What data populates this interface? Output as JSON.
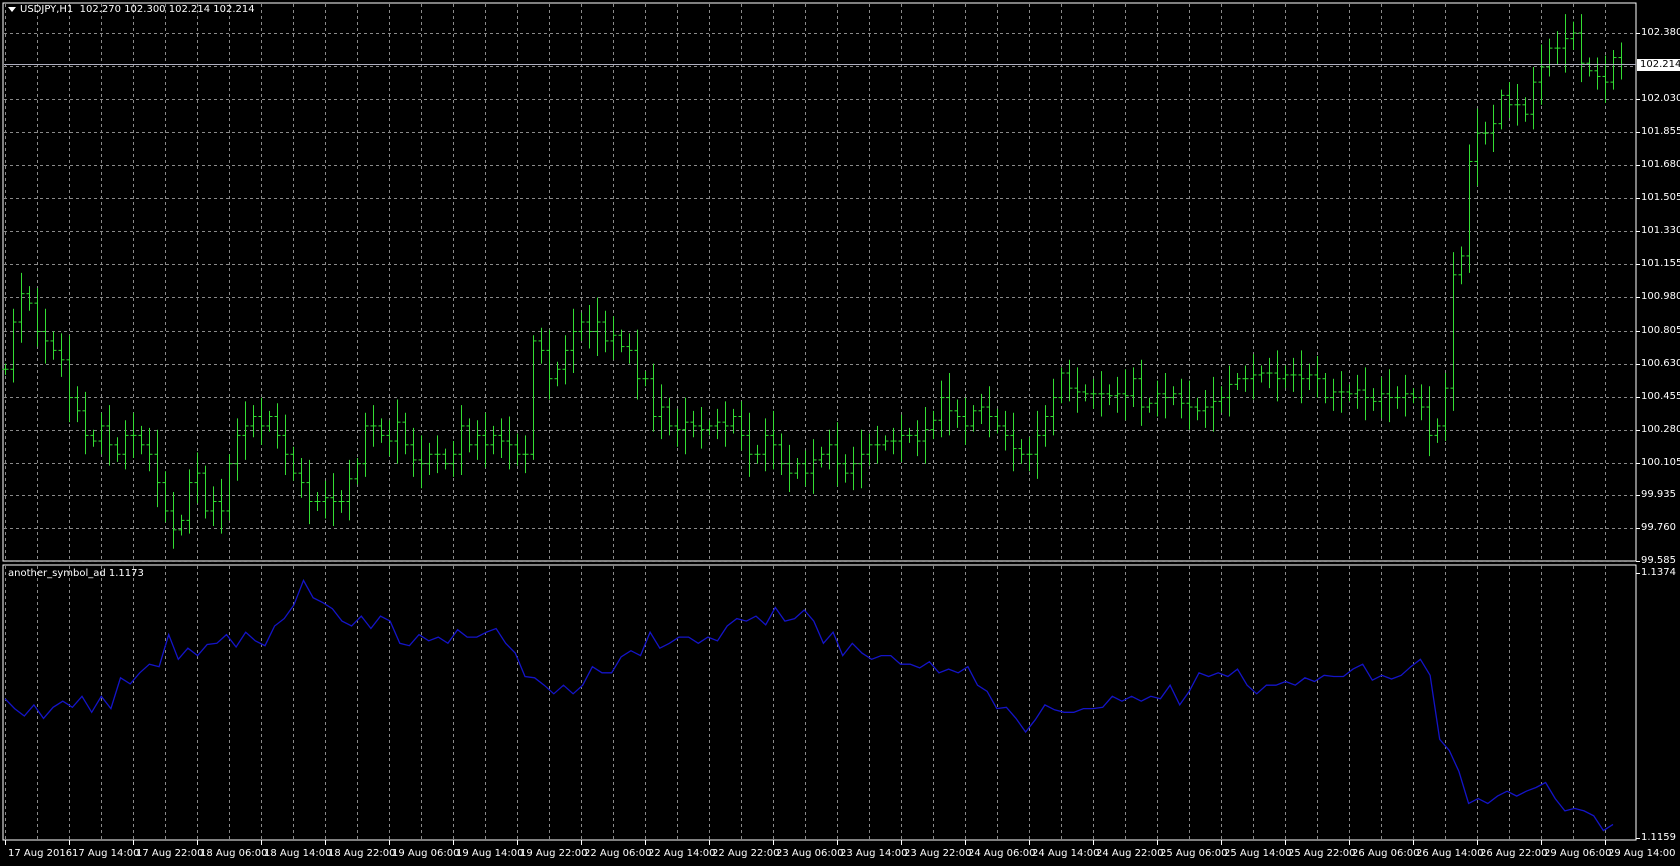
{
  "header": {
    "symbol": "USDJPY,H1",
    "ohlc": "102.270 102.300 102.214 102.214"
  },
  "indicator": {
    "label": "another_symbol_ad 1.1173"
  },
  "bid_label": "102.214",
  "colors": {
    "bars": "#33dd33",
    "indicator": "#1414c8",
    "grid": "#8a8a8a",
    "background": "#000000",
    "frame": "#ffffff"
  },
  "price_axis": [
    "102.380",
    "102.030",
    "101.855",
    "101.680",
    "101.505",
    "101.330",
    "101.155",
    "100.980",
    "100.805",
    "100.630",
    "100.455",
    "100.280",
    "100.105",
    "99.935",
    "99.760",
    "99.585"
  ],
  "indicator_axis": [
    "1.1374",
    "1.1159"
  ],
  "time_axis": [
    "17 Aug 2016",
    "17 Aug 14:00",
    "17 Aug 22:00",
    "18 Aug 06:00",
    "18 Aug 14:00",
    "18 Aug 22:00",
    "19 Aug 06:00",
    "19 Aug 14:00",
    "19 Aug 22:00",
    "22 Aug 06:00",
    "22 Aug 14:00",
    "22 Aug 22:00",
    "23 Aug 06:00",
    "23 Aug 14:00",
    "23 Aug 22:00",
    "24 Aug 06:00",
    "24 Aug 14:00",
    "24 Aug 22:00",
    "25 Aug 06:00",
    "25 Aug 14:00",
    "25 Aug 22:00",
    "26 Aug 06:00",
    "26 Aug 14:00",
    "26 Aug 22:00",
    "29 Aug 06:00",
    "29 Aug 14:00"
  ],
  "chart_data": [
    {
      "type": "ohlc",
      "title": "USDJPY,H1",
      "ylim": [
        99.585,
        102.38
      ],
      "bid": 102.214,
      "closes": [
        100.6,
        100.85,
        101.0,
        100.95,
        100.8,
        100.75,
        100.7,
        100.65,
        100.45,
        100.38,
        100.25,
        100.22,
        100.3,
        100.2,
        100.15,
        100.25,
        100.25,
        100.2,
        100.15,
        100.0,
        99.85,
        99.75,
        99.8,
        100.0,
        100.05,
        99.85,
        99.9,
        99.85,
        100.1,
        100.25,
        100.3,
        100.35,
        100.3,
        100.35,
        100.25,
        100.15,
        100.05,
        100.0,
        99.9,
        99.9,
        99.92,
        99.9,
        99.9,
        100.02,
        100.1,
        100.3,
        100.3,
        100.25,
        100.22,
        100.32,
        100.2,
        100.12,
        100.1,
        100.15,
        100.15,
        100.1,
        100.15,
        100.3,
        100.2,
        100.25,
        100.2,
        100.25,
        100.22,
        100.2,
        100.15,
        100.15,
        100.75,
        100.7,
        100.55,
        100.6,
        100.7,
        100.8,
        100.85,
        100.8,
        100.85,
        100.75,
        100.78,
        100.72,
        100.7,
        100.55,
        100.55,
        100.35,
        100.4,
        100.3,
        100.28,
        100.32,
        100.3,
        100.28,
        100.3,
        100.32,
        100.3,
        100.35,
        100.25,
        100.15,
        100.15,
        100.25,
        100.2,
        100.1,
        100.05,
        100.1,
        100.05,
        100.12,
        100.15,
        100.2,
        100.1,
        100.05,
        100.1,
        100.15,
        100.2,
        100.2,
        100.22,
        100.22,
        100.25,
        100.25,
        100.22,
        100.28,
        100.33,
        100.45,
        100.38,
        100.35,
        100.3,
        100.38,
        100.4,
        100.35,
        100.3,
        100.25,
        100.18,
        100.15,
        100.15,
        100.25,
        100.35,
        100.45,
        100.58,
        100.5,
        100.48,
        100.47,
        100.47,
        100.47,
        100.46,
        100.47,
        100.46,
        100.55,
        100.4,
        100.42,
        100.47,
        100.45,
        100.47,
        100.42,
        100.4,
        100.38,
        100.4,
        100.43,
        100.45,
        100.52,
        100.55,
        100.55,
        100.57,
        100.58,
        100.58,
        100.55,
        100.57,
        100.57,
        100.55,
        100.57,
        100.55,
        100.45,
        100.48,
        100.48,
        100.47,
        100.49,
        100.45,
        100.43,
        100.47,
        100.45,
        100.45,
        100.47,
        100.45,
        100.4,
        100.25,
        100.3,
        100.5,
        101.1,
        101.2,
        101.7,
        101.85,
        101.85,
        101.9,
        102.05,
        102.0,
        102.0,
        101.95,
        102.12,
        102.2,
        102.3,
        102.3,
        102.35,
        102.38,
        102.22,
        102.18,
        102.15,
        102.12,
        102.25,
        102.214
      ]
    },
    {
      "type": "line",
      "title": "another_symbol_ad",
      "ylim": [
        1.1159,
        1.1374
      ],
      "last": 1.1173,
      "values": [
        1.1272,
        1.1264,
        1.1258,
        1.1267,
        1.1256,
        1.1265,
        1.127,
        1.1265,
        1.1274,
        1.1261,
        1.1274,
        1.1264,
        1.1289,
        1.1284,
        1.1293,
        1.13,
        1.1298,
        1.1324,
        1.1304,
        1.1313,
        1.1307,
        1.1316,
        1.1317,
        1.1324,
        1.1314,
        1.1326,
        1.1319,
        1.1315,
        1.1331,
        1.1337,
        1.1348,
        1.1368,
        1.1354,
        1.135,
        1.1345,
        1.1335,
        1.1331,
        1.1339,
        1.1329,
        1.1339,
        1.1335,
        1.1317,
        1.1315,
        1.1324,
        1.1319,
        1.1322,
        1.1317,
        1.1328,
        1.1322,
        1.1322,
        1.1326,
        1.1329,
        1.1317,
        1.1309,
        1.129,
        1.1289,
        1.1283,
        1.1276,
        1.1283,
        1.1276,
        1.1283,
        1.1298,
        1.1293,
        1.1293,
        1.1306,
        1.1311,
        1.1307,
        1.1326,
        1.1313,
        1.1317,
        1.1322,
        1.1322,
        1.1317,
        1.1322,
        1.1319,
        1.1331,
        1.1337,
        1.1335,
        1.1339,
        1.1332,
        1.1346,
        1.1335,
        1.1337,
        1.1344,
        1.1335,
        1.1317,
        1.1326,
        1.1307,
        1.1317,
        1.1309,
        1.1304,
        1.1307,
        1.1307,
        1.13,
        1.13,
        1.1297,
        1.1302,
        1.1293,
        1.1296,
        1.1293,
        1.1298,
        1.1283,
        1.1278,
        1.1264,
        1.1265,
        1.1256,
        1.1245,
        1.1255,
        1.1267,
        1.1263,
        1.1261,
        1.1261,
        1.1264,
        1.1264,
        1.1265,
        1.1274,
        1.127,
        1.1274,
        1.127,
        1.1274,
        1.1272,
        1.1283,
        1.1267,
        1.1278,
        1.1293,
        1.129,
        1.1293,
        1.129,
        1.1296,
        1.1283,
        1.1276,
        1.1283,
        1.1283,
        1.1286,
        1.1283,
        1.1289,
        1.1286,
        1.1291,
        1.129,
        1.129,
        1.1296,
        1.13,
        1.1287,
        1.1291,
        1.1288,
        1.1291,
        1.1298,
        1.1304,
        1.1291,
        1.1239,
        1.123,
        1.1213,
        1.1187,
        1.1191,
        1.1187,
        1.1193,
        1.1197,
        1.1193,
        1.1197,
        1.12,
        1.1204,
        1.1191,
        1.1181,
        1.1183,
        1.1181,
        1.1177,
        1.1165,
        1.117
      ]
    }
  ]
}
